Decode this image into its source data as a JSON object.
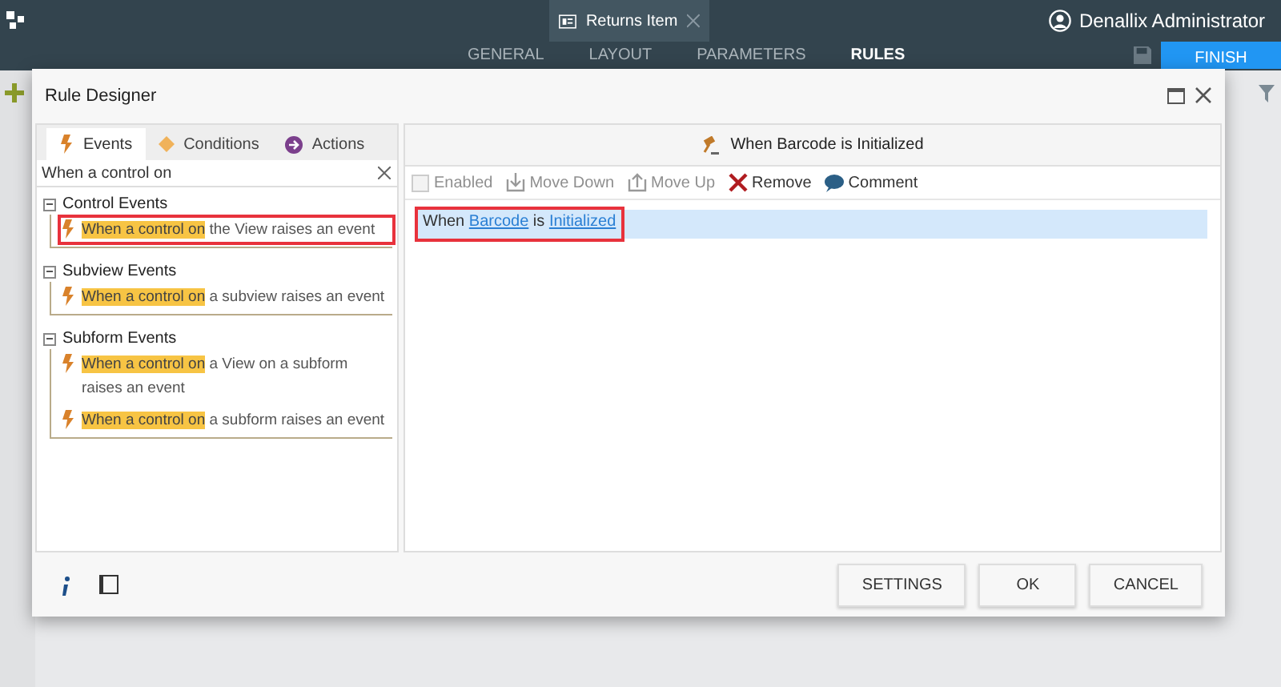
{
  "app_bar": {
    "form_tab": {
      "title": "Returns Item"
    },
    "user": "Denallix Administrator"
  },
  "nav_tabs": [
    {
      "label": "GENERAL",
      "selected": false
    },
    {
      "label": "LAYOUT",
      "selected": false
    },
    {
      "label": "PARAMETERS",
      "selected": false
    },
    {
      "label": "RULES",
      "selected": true
    }
  ],
  "finish_button": "FINISH",
  "dialog": {
    "title": "Rule Designer",
    "panel_tabs": [
      {
        "label": "Events",
        "selected": true
      },
      {
        "label": "Conditions",
        "selected": false
      },
      {
        "label": "Actions",
        "selected": false
      }
    ],
    "search": {
      "value": "When a control on"
    },
    "tree": [
      {
        "label": "Control Events",
        "expanded": true,
        "children": [
          {
            "match": "When a control on",
            "rest": " the View raises an event",
            "outlined": true
          }
        ]
      },
      {
        "label": "Subview Events",
        "expanded": true,
        "children": [
          {
            "match": "When a control on",
            "rest": " a subview raises an event",
            "outlined": false
          }
        ]
      },
      {
        "label": "Subform Events",
        "expanded": true,
        "children": [
          {
            "match": "When a control on",
            "rest": " a View on a subform raises an event",
            "outlined": false
          },
          {
            "match": "When a control on",
            "rest": " a subform raises an event",
            "outlined": false
          }
        ]
      }
    ],
    "rule_title": "When Barcode is Initialized",
    "toolbar": [
      {
        "kind": "checkbox",
        "label": "Enabled",
        "disabled": true
      },
      {
        "kind": "move-down",
        "label": "Move Down",
        "disabled": true
      },
      {
        "kind": "move-up",
        "label": "Move Up",
        "disabled": true
      },
      {
        "kind": "remove",
        "label": "Remove",
        "disabled": false
      },
      {
        "kind": "comment",
        "label": "Comment",
        "disabled": false
      }
    ],
    "rule": {
      "outlined": true,
      "parts": [
        {
          "kind": "text",
          "text": "When "
        },
        {
          "kind": "link",
          "text": "Barcode"
        },
        {
          "kind": "text",
          "text": " is "
        },
        {
          "kind": "link",
          "text": "Initialized"
        }
      ]
    },
    "buttons": [
      "SETTINGS",
      "OK",
      "CANCEL"
    ]
  }
}
